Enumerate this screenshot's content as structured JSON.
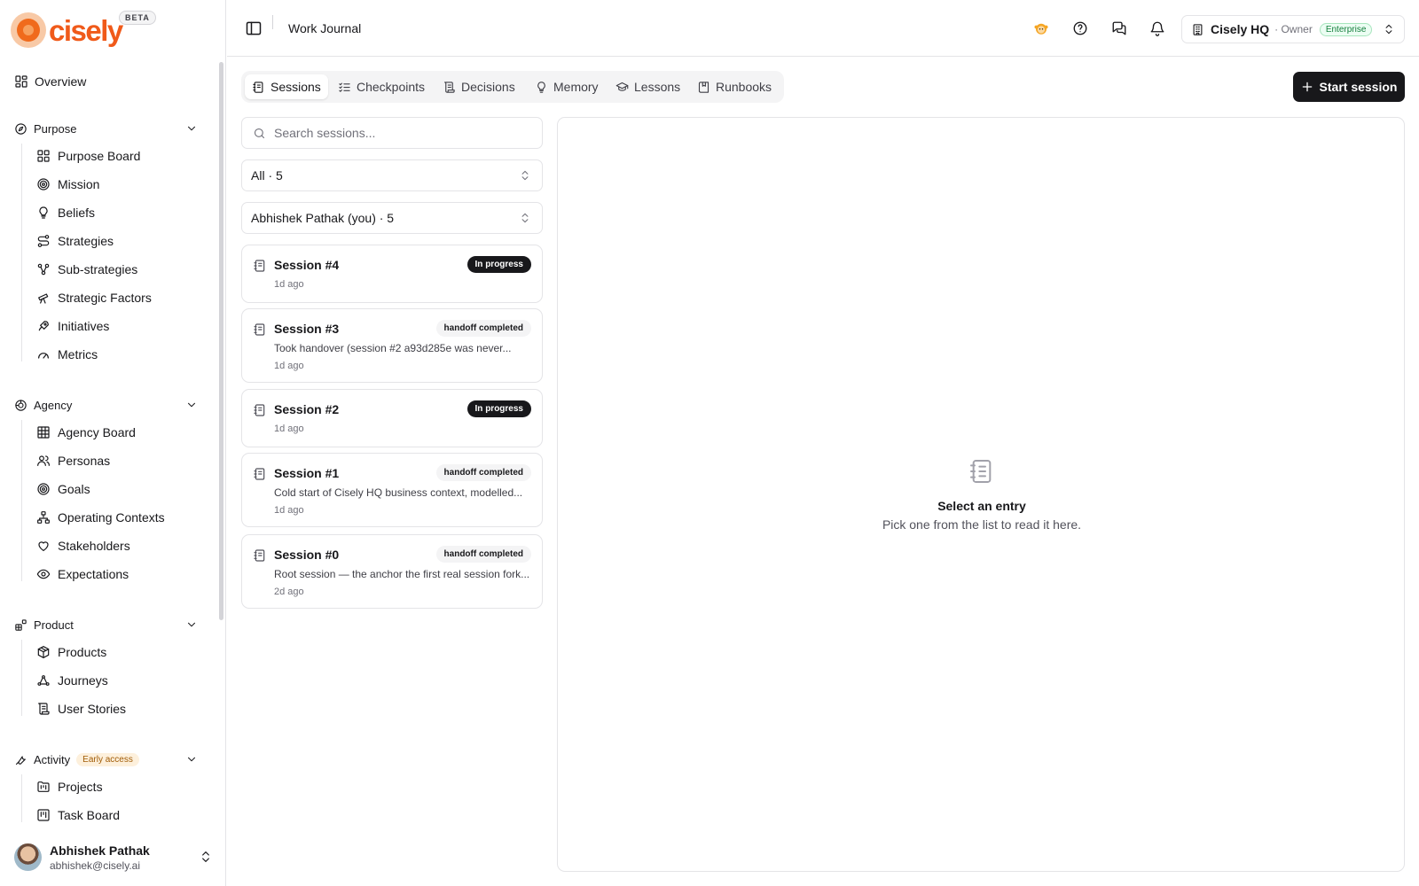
{
  "brand": {
    "name": "cisely",
    "badge": "BETA"
  },
  "nav": {
    "overview": "Overview",
    "sections": [
      {
        "title": "Purpose",
        "items": [
          "Purpose Board",
          "Mission",
          "Beliefs",
          "Strategies",
          "Sub-strategies",
          "Strategic Factors",
          "Initiatives",
          "Metrics"
        ]
      },
      {
        "title": "Agency",
        "items": [
          "Agency Board",
          "Personas",
          "Goals",
          "Operating Contexts",
          "Stakeholders",
          "Expectations"
        ]
      },
      {
        "title": "Product",
        "items": [
          "Products",
          "Journeys",
          "User Stories"
        ]
      },
      {
        "title": "Activity",
        "badge": "Early access",
        "items": [
          "Projects",
          "Task Board"
        ]
      }
    ]
  },
  "user": {
    "name": "Abhishek Pathak",
    "email": "abhishek@cisely.ai"
  },
  "header": {
    "title": "Work Journal",
    "org": {
      "name": "Cisely HQ",
      "role": "· Owner",
      "plan": "Enterprise"
    }
  },
  "tabs": [
    "Sessions",
    "Checkpoints",
    "Decisions",
    "Memory",
    "Lessons",
    "Runbooks"
  ],
  "start_label": "Start session",
  "search": {
    "placeholder": "Search sessions..."
  },
  "filters": {
    "status": "All · 5",
    "owner": "Abhishek Pathak (you) · 5"
  },
  "sessions": [
    {
      "title": "Session #4",
      "badge": "In progress",
      "summary": "",
      "time": "1d ago"
    },
    {
      "title": "Session #3",
      "badge": "handoff completed",
      "summary": "Took handover (session #2 a93d285e was never...",
      "time": "1d ago"
    },
    {
      "title": "Session #2",
      "badge": "In progress",
      "summary": "",
      "time": "1d ago"
    },
    {
      "title": "Session #1",
      "badge": "handoff completed",
      "summary": "Cold start of Cisely HQ business context, modelled...",
      "time": "1d ago"
    },
    {
      "title": "Session #0",
      "badge": "handoff completed",
      "summary": "Root session — the anchor the first real session fork...",
      "time": "2d ago"
    }
  ],
  "empty": {
    "title": "Select an entry",
    "subtitle": "Pick one from the list to read it here."
  },
  "colors": {
    "brand": "#f05a1a",
    "primary": "#18181b",
    "border": "#e4e4e7",
    "enterprise": "#15803d",
    "early_access": "#a15c07"
  }
}
